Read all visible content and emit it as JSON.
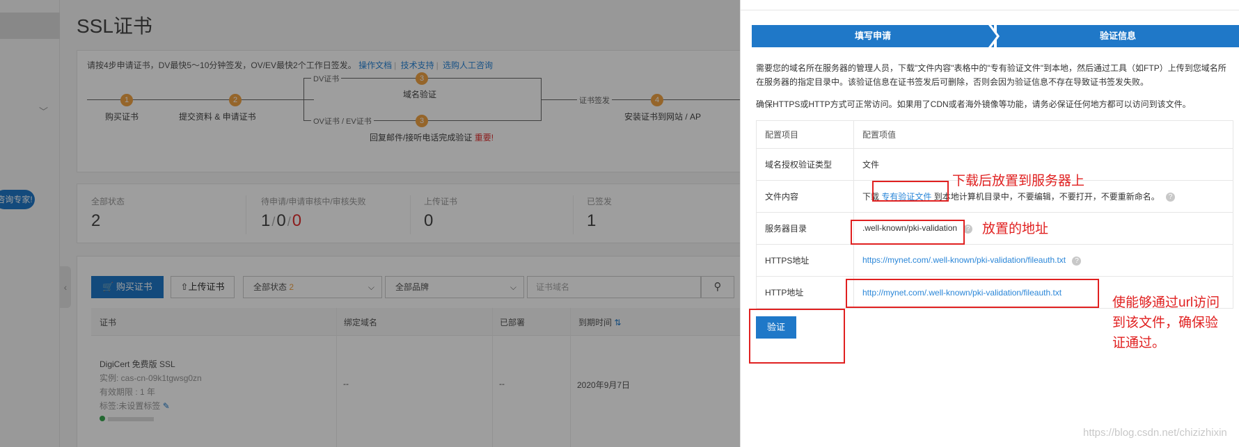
{
  "page": {
    "title": "SSL证书",
    "expert_button": "咨询专家!",
    "intro_text": "请按4步申请证书，DV最快5～10分钟签发，OV/EV最快2个工作日签发。",
    "links": [
      "操作文档",
      "技术支持",
      "选购人工咨询"
    ]
  },
  "flow": {
    "steps": [
      {
        "num": "1",
        "label": "购买证书"
      },
      {
        "num": "2",
        "label": "提交资料 & 申请证书"
      },
      {
        "num": "3",
        "label": "域名验证",
        "branch": "DV证书"
      },
      {
        "num": "3",
        "label": "回复邮件/接听电话完成验证",
        "branch": "OV证书 / EV证书",
        "important": "重要!"
      },
      {
        "num": "4",
        "label": "安装证书到网站 / AP",
        "branch": "证书签发"
      }
    ]
  },
  "stats": [
    {
      "label": "全部状态",
      "value": "2"
    },
    {
      "label": "待申请/申请审核中/审核失败",
      "values": [
        "1",
        "0",
        "0"
      ]
    },
    {
      "label": "上传证书",
      "value": "0"
    },
    {
      "label": "已签发",
      "value": "1"
    }
  ],
  "toolbar": {
    "buy_label": "购买证书",
    "upload_label": "上传证书",
    "status_select": "全部状态",
    "status_count": "2",
    "brand_select": "全部品牌",
    "search_placeholder": "证书域名"
  },
  "table": {
    "columns": [
      "证书",
      "绑定域名",
      "已部署",
      "到期时间"
    ],
    "rows": [
      {
        "name": "DigiCert 免费版 SSL",
        "instance": "实例: cas-cn-09k1tgwsg0zn",
        "validity": "有效期限 : 1 年",
        "tag": "标签:未设置标签",
        "domain": "--",
        "deployed": "--",
        "expires": "2020年9月7日"
      }
    ]
  },
  "drawer": {
    "wizard": [
      "填写申请",
      "验证信息"
    ],
    "desc1": "需要您的域名所在服务器的管理人员，下载\"文件内容\"表格中的\"专有验证文件\"到本地，然后通过工具（如FTP）上传到您域名所在服务器的指定目录中。该验证信息在证书签发后可删除，否则会因为验证信息不存在导致证书签发失败。",
    "desc2": "确保HTTPS或HTTP方式可正常访问。如果用了CDN或者海外镜像等功能，请务必保证任何地方都可以访问到该文件。",
    "table_header": [
      "配置项目",
      "配置项值"
    ],
    "rows": [
      {
        "key": "域名授权验证类型",
        "value": "文件"
      },
      {
        "key": "文件内容",
        "prefix": "下载",
        "link": "专有验证文件",
        "suffix": "到本地计算机目录中，不要编辑，不要打开，不要重新命名。"
      },
      {
        "key": "服务器目录",
        "value": ".well-known/pki-validation"
      },
      {
        "key": "HTTPS地址",
        "link": "https://mynet.com/.well-known/pki-validation/fileauth.txt"
      },
      {
        "key": "HTTP地址",
        "link": "http://mynet.com/.well-known/pki-validation/fileauth.txt"
      }
    ],
    "verify_button": "验证"
  },
  "annotations": {
    "download": "下载后放置到服务器上",
    "location": "放置的地址",
    "url": [
      "使能够通过url访问",
      "到该文件，确保验",
      "证通过。"
    ]
  },
  "watermark": "https://blog.csdn.net/chizizhixin",
  "colors": {
    "brand": "#1f78c8",
    "step": "#f0a345",
    "annotation": "#e02020"
  }
}
